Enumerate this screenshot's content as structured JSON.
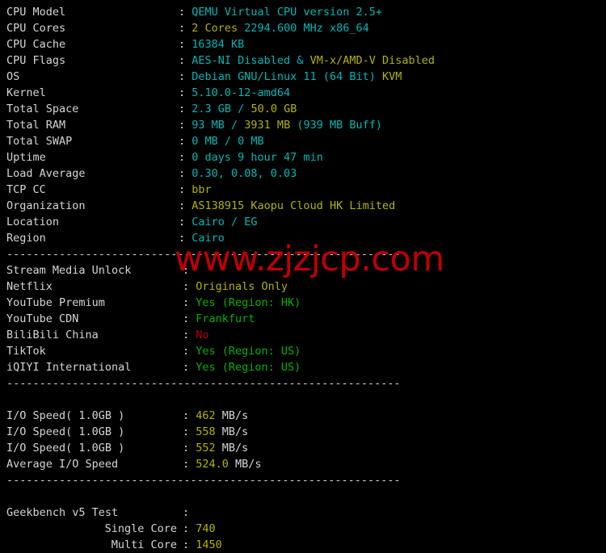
{
  "terminal": {
    "background_color": "#000000",
    "default_text_color": "#d6d6d6",
    "palette": {
      "cyan": "#00b6b6",
      "yellow": "#b3b300",
      "green": "#00b200",
      "red": "#b00000",
      "white": "#d6d6d6",
      "watermark_red": "#c00000"
    },
    "separator": "------------------------------------------------------------",
    "colon": ":"
  },
  "watermark": {
    "text": "www.zjzjcp.com"
  },
  "sections": {
    "system": {
      "rows": [
        {
          "label": "CPU Model",
          "parts": [
            {
              "text": "QEMU Virtual CPU version 2.5+",
              "color": "cyan"
            }
          ]
        },
        {
          "label": "CPU Cores",
          "parts": [
            {
              "text": "2 Cores",
              "color": "yellow"
            },
            {
              "text": " 2294.600 MHz x86_64",
              "color": "cyan"
            }
          ]
        },
        {
          "label": "CPU Cache",
          "parts": [
            {
              "text": "16384 KB",
              "color": "cyan"
            }
          ]
        },
        {
          "label": "CPU Flags",
          "parts": [
            {
              "text": "AES-NI Disabled",
              "color": "cyan"
            },
            {
              "text": " & ",
              "color": "cyan"
            },
            {
              "text": "VM-x/AMD-V Disabled",
              "color": "yellow"
            }
          ]
        },
        {
          "label": "OS",
          "parts": [
            {
              "text": "Debian GNU/Linux 11 (64 Bit)",
              "color": "cyan"
            },
            {
              "text": " KVM",
              "color": "yellow"
            }
          ]
        },
        {
          "label": "Kernel",
          "parts": [
            {
              "text": "5.10.0-12-amd64",
              "color": "cyan"
            }
          ]
        },
        {
          "label": "Total Space",
          "parts": [
            {
              "text": "2.3 GB",
              "color": "cyan"
            },
            {
              "text": " / ",
              "color": "cyan"
            },
            {
              "text": "50.0 GB",
              "color": "yellow"
            }
          ]
        },
        {
          "label": "Total RAM",
          "parts": [
            {
              "text": "93 MB",
              "color": "cyan"
            },
            {
              "text": " / ",
              "color": "cyan"
            },
            {
              "text": "3931 MB",
              "color": "yellow"
            },
            {
              "text": " (939 MB Buff)",
              "color": "cyan"
            }
          ]
        },
        {
          "label": "Total SWAP",
          "parts": [
            {
              "text": "0 MB / 0 MB",
              "color": "cyan"
            }
          ]
        },
        {
          "label": "Uptime",
          "parts": [
            {
              "text": "0 days 9 hour 47 min",
              "color": "cyan"
            }
          ]
        },
        {
          "label": "Load Average",
          "parts": [
            {
              "text": "0.30, 0.08, 0.03",
              "color": "cyan"
            }
          ]
        },
        {
          "label": "TCP CC",
          "parts": [
            {
              "text": "bbr",
              "color": "yellow"
            }
          ]
        },
        {
          "label": "Organization",
          "parts": [
            {
              "text": "AS138915 Kaopu Cloud HK Limited",
              "color": "yellow"
            }
          ]
        },
        {
          "label": "Location",
          "parts": [
            {
              "text": "Cairo / EG",
              "color": "cyan"
            }
          ]
        },
        {
          "label": "Region",
          "parts": [
            {
              "text": "Cairo",
              "color": "cyan"
            }
          ]
        }
      ]
    },
    "stream_media": {
      "rows": [
        {
          "label": "Stream Media Unlock",
          "parts": []
        },
        {
          "label": "Netflix",
          "parts": [
            {
              "text": "Originals Only",
              "color": "yellow"
            }
          ]
        },
        {
          "label": "YouTube Premium",
          "parts": [
            {
              "text": "Yes (Region: HK)",
              "color": "green"
            }
          ]
        },
        {
          "label": "YouTube CDN",
          "parts": [
            {
              "text": "Frankfurt",
              "color": "green"
            }
          ]
        },
        {
          "label": "BiliBili China",
          "parts": [
            {
              "text": "No",
              "color": "red"
            }
          ]
        },
        {
          "label": "TikTok",
          "parts": [
            {
              "text": "Yes (Region: US)",
              "color": "green"
            }
          ]
        },
        {
          "label": "iQIYI International",
          "parts": [
            {
              "text": "Yes (Region: US)",
              "color": "green"
            }
          ]
        }
      ]
    },
    "io_speed": {
      "rows": [
        {
          "label": "I/O Speed( 1.0GB )",
          "parts": [
            {
              "text": "462",
              "color": "yellow"
            },
            {
              "text": " MB/s",
              "color": "white"
            }
          ]
        },
        {
          "label": "I/O Speed( 1.0GB )",
          "parts": [
            {
              "text": "558",
              "color": "yellow"
            },
            {
              "text": " MB/s",
              "color": "white"
            }
          ]
        },
        {
          "label": "I/O Speed( 1.0GB )",
          "parts": [
            {
              "text": "552",
              "color": "yellow"
            },
            {
              "text": " MB/s",
              "color": "white"
            }
          ]
        },
        {
          "label": "Average I/O Speed",
          "parts": [
            {
              "text": "524.0",
              "color": "yellow"
            },
            {
              "text": " MB/s",
              "color": "white"
            }
          ]
        }
      ]
    },
    "geekbench": {
      "rows": [
        {
          "label": "Geekbench v5 Test",
          "align": "left",
          "parts": []
        },
        {
          "label": "Single Core",
          "align": "right",
          "parts": [
            {
              "text": "740",
              "color": "yellow"
            }
          ]
        },
        {
          "label": "Multi Core",
          "align": "right",
          "parts": [
            {
              "text": "1450",
              "color": "yellow"
            }
          ]
        }
      ]
    }
  }
}
